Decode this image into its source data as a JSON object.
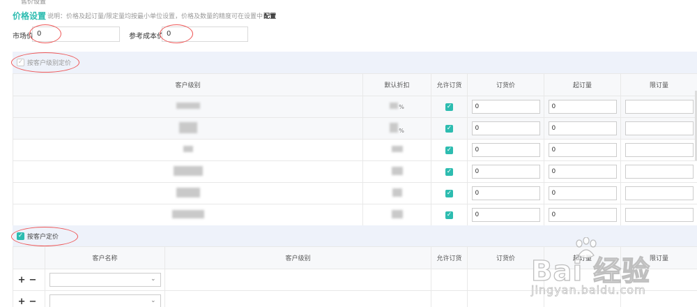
{
  "section_clip": "售价设置",
  "price_settings": {
    "title": "价格设置",
    "description": "说明：价格及起订量/限定量均按最小单位设置，价格及数量的精度可在设置中",
    "config_link": "配置"
  },
  "market_price": {
    "label": "市场价",
    "value": "0"
  },
  "ref_cost": {
    "label": "参考成本价",
    "value": "0"
  },
  "level_pricing": {
    "label": "按客户级别定价",
    "checked": true,
    "columns": [
      "客户级别",
      "默认折扣",
      "允许订货",
      "订货价",
      "起订量",
      "限订量"
    ],
    "rows": [
      {
        "price": "0",
        "min_qty": "0",
        "max_qty": "",
        "allow": true,
        "pct": "%"
      },
      {
        "price": "0",
        "min_qty": "0",
        "max_qty": "",
        "allow": true,
        "pct": "%"
      },
      {
        "price": "0",
        "min_qty": "0",
        "max_qty": "",
        "allow": true,
        "pct": ""
      },
      {
        "price": "0",
        "min_qty": "0",
        "max_qty": "",
        "allow": true,
        "pct": ""
      },
      {
        "price": "0",
        "min_qty": "0",
        "max_qty": "",
        "allow": true,
        "pct": ""
      },
      {
        "price": "0",
        "min_qty": "0",
        "max_qty": "",
        "allow": true,
        "pct": ""
      }
    ]
  },
  "customer_pricing": {
    "label": "按客户定价",
    "checked": true,
    "columns": [
      "",
      "客户名称",
      "客户级别",
      "允许订货",
      "订货价",
      "起订量",
      "限订量"
    ],
    "add_symbol": "+",
    "remove_symbol": "−"
  },
  "watermark": {
    "brand": "Bai 经验",
    "domain": "jingyan.baidu.com"
  },
  "icons": {
    "check": "check-icon",
    "chevron": "chevron-down-icon"
  },
  "colors": {
    "accent": "#2dbcb0",
    "section_bg": "#eef2fa",
    "annotation": "#e55555"
  }
}
